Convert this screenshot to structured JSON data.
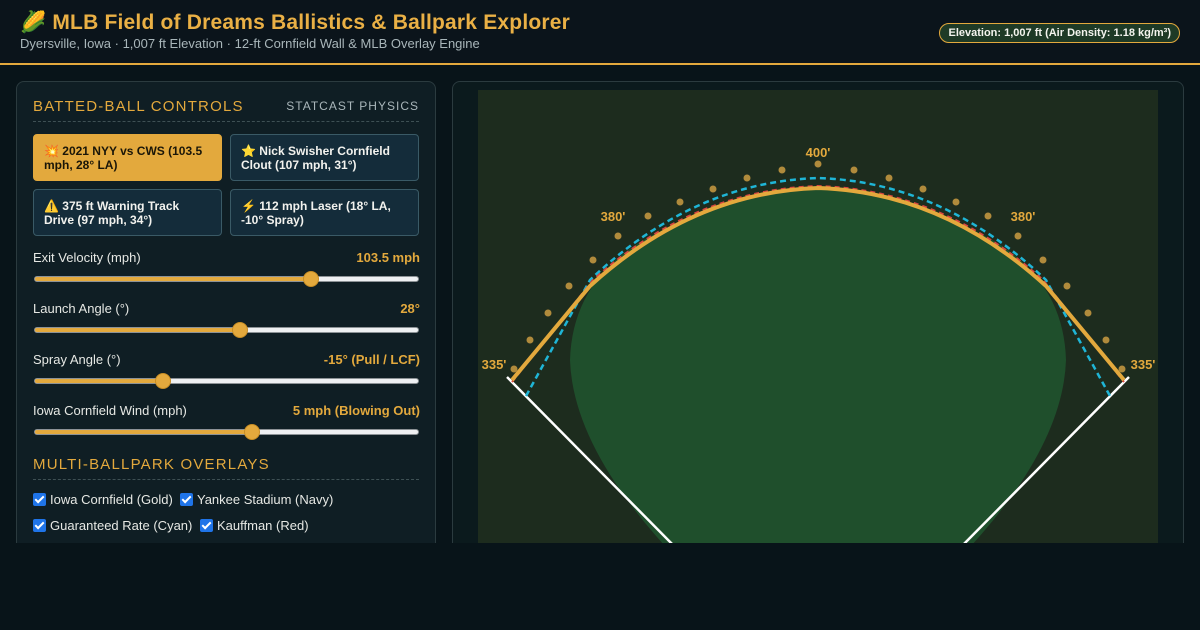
{
  "header": {
    "icon": "corn-icon",
    "icon_glyph": "🌽",
    "title": "MLB Field of Dreams Ballistics & Ballpark Explorer",
    "subtitle": "Dyersville, Iowa · 1,007 ft Elevation · 12-ft Cornfield Wall & MLB Overlay Engine",
    "elevation_badge": "Elevation: 1,007 ft (Air Density: 1.18 kg/m³)"
  },
  "controls": {
    "title": "BATTED-BALL CONTROLS",
    "tag": "STATCAST PHYSICS",
    "presets": [
      {
        "label": "💥 2021 NYY vs CWS (103.5 mph, 28° LA)",
        "active": true
      },
      {
        "label": "⭐ Nick Swisher Cornfield Clout (107 mph, 31°)",
        "active": false
      },
      {
        "label": "⚠️ 375 ft Warning Track Drive (97 mph, 34°)",
        "active": false
      },
      {
        "label": "⚡ 112 mph Laser (18° LA, -10° Spray)",
        "active": false
      }
    ],
    "sliders": [
      {
        "label": "Exit Velocity (mph)",
        "value": "103.5 mph",
        "fraction": 0.72
      },
      {
        "label": "Launch Angle (°)",
        "value": "28°",
        "fraction": 0.535
      },
      {
        "label": "Spray Angle (°)",
        "value": "-15° (Pull / LCF)",
        "fraction": 0.335
      },
      {
        "label": "Iowa Cornfield Wind (mph)",
        "value": "5 mph (Blowing Out)",
        "fraction": 0.565
      }
    ]
  },
  "overlays": {
    "title": "MULTI-BALLPARK OVERLAYS",
    "items": [
      {
        "label": "Iowa Cornfield (Gold)",
        "checked": true
      },
      {
        "label": "Yankee Stadium (Navy)",
        "checked": true
      },
      {
        "label": "Guaranteed Rate (Cyan)",
        "checked": true
      },
      {
        "label": "Kauffman (Red)",
        "checked": true
      }
    ]
  },
  "field": {
    "distance_labels": {
      "center": "400'",
      "left_center": "380'",
      "right_center": "380'",
      "left": "335'",
      "right": "335'"
    },
    "colors": {
      "gold": "#e3a93d",
      "cyan": "#1fb5d6",
      "red": "#d9463f",
      "grass": "#1f4f2c",
      "outfield_bg": "#1d2c1e",
      "foul_line": "#ffffff"
    }
  }
}
